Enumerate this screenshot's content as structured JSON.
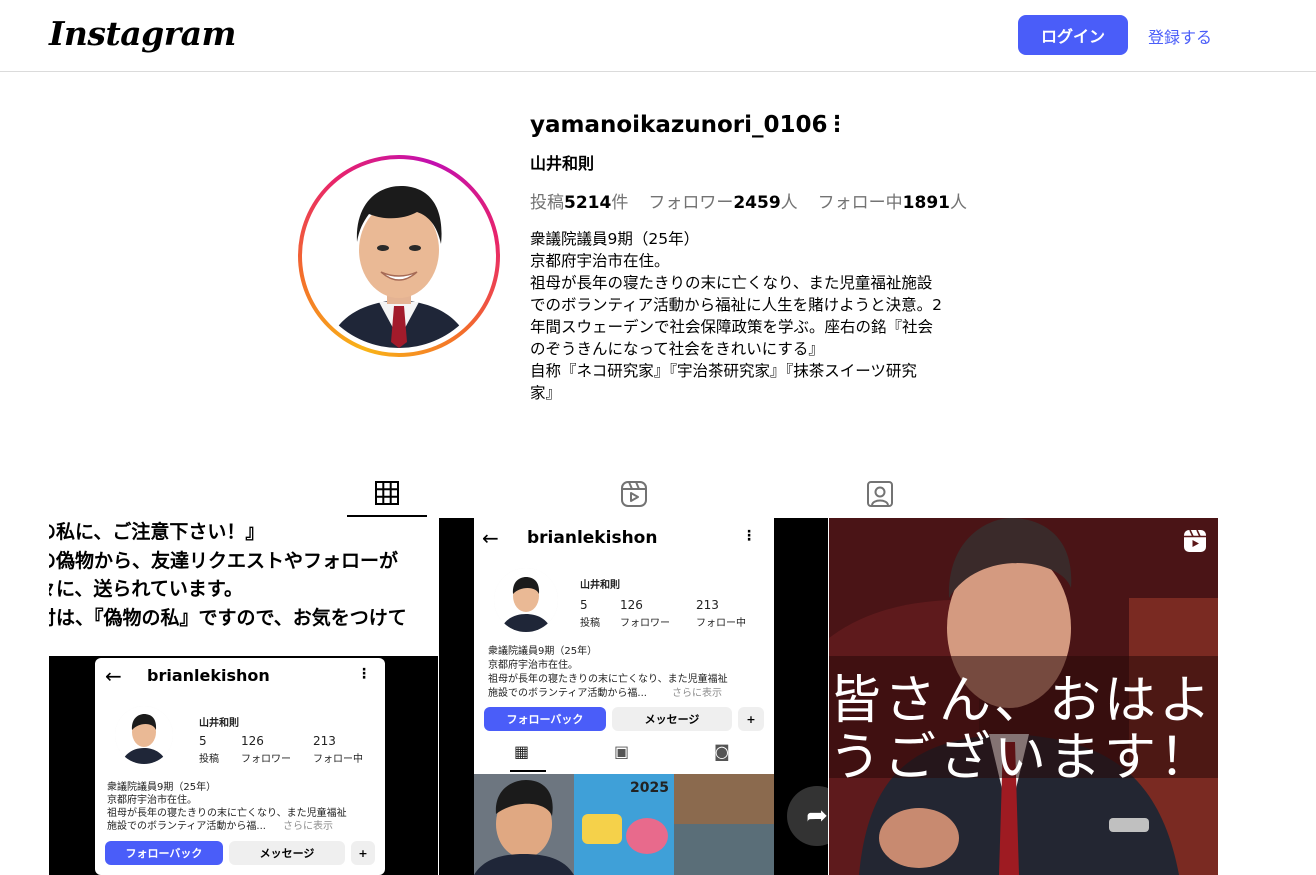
{
  "header": {
    "logo": "Instagram",
    "login_label": "ログイン",
    "signup_label": "登録する"
  },
  "profile": {
    "username": "yamanoikazunori_0106",
    "full_name": "山井和則",
    "stats": {
      "posts_prefix": "投稿",
      "posts_count": "5214",
      "posts_suffix": "件",
      "followers_prefix": "フォロワー",
      "followers_count": "2459",
      "followers_suffix": "人",
      "following_prefix": "フォロー中",
      "following_count": "1891",
      "following_suffix": "人"
    },
    "bio_lines": [
      "衆議院議員9期（25年）",
      "京都府宇治市在住。",
      "祖母が長年の寝たきりの末に亡くなり、また児童福祉施設",
      "でのボランティア活動から福祉に人生を賭けようと決意。2",
      "年間スウェーデンで社会保障政策を学ぶ。座右の銘『社会",
      "のぞうきんになって社会をきれいにする』",
      "自称『ネコ研究家』『宇治茶研究家』『抹茶スイーツ研究",
      "家』"
    ]
  },
  "tabs": [
    {
      "icon": "grid-icon",
      "active": true
    },
    {
      "icon": "reels-icon",
      "active": false
    },
    {
      "icon": "tagged-icon",
      "active": false
    }
  ],
  "posts": {
    "post1": {
      "text_lines": [
        "の私に、ご注意下さい！』",
        "の偽物から、友達リクエストやフォローが",
        "々に、送られています。",
        "付は、『偽物の私』ですので、お気をつけて"
      ],
      "card": {
        "username": "brianlekishon",
        "name": "山井和則",
        "posts_count": "5",
        "posts_label": "投稿",
        "followers_count": "126",
        "followers_label": "フォロワー",
        "following_count": "213",
        "following_label": "フォロー中",
        "bio1": "衆議院議員9期（25年）",
        "bio2": "京都府宇治市在住。",
        "bio3": "祖母が長年の寝たきりの末に亡くなり、また児童福祉",
        "bio4": "施設でのボランティア活動から福...",
        "more": "さらに表示",
        "follow_back": "フォローバック",
        "message": "メッセージ"
      }
    },
    "post2": {
      "card": {
        "username": "brianlekishon",
        "name": "山井和則",
        "posts_count": "5",
        "posts_label": "投稿",
        "followers_count": "126",
        "followers_label": "フォロワー",
        "following_count": "213",
        "following_label": "フォロー中",
        "bio1": "衆議院議員9期（25年）",
        "bio2": "京都府宇治市在住。",
        "bio3": "祖母が長年の寝たきりの末に亡くなり、また児童福祉",
        "bio4": "施設でのボランティア活動から福...",
        "more": "さらに表示",
        "follow_back": "フォローバック",
        "message": "メッセージ",
        "thumb_year": "2025"
      }
    },
    "post3": {
      "caption_line1": "皆さん、おはよ",
      "caption_line2": "うございます！"
    }
  }
}
